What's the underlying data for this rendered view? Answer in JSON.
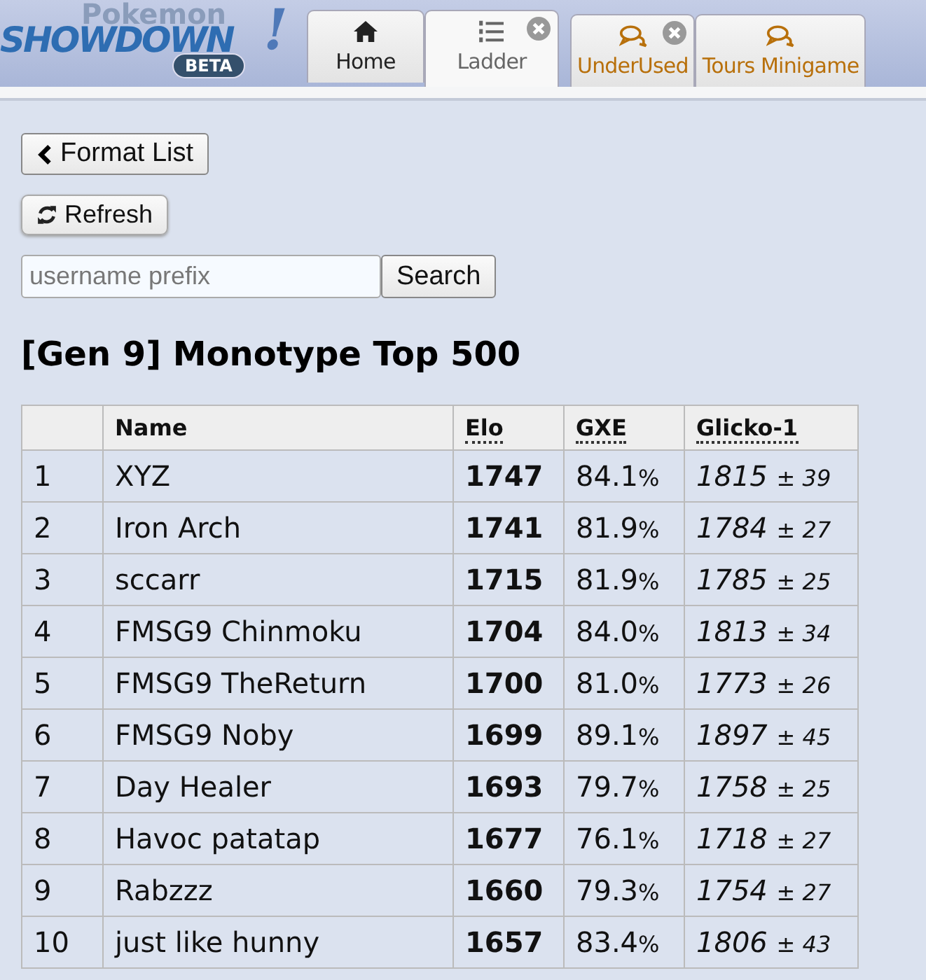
{
  "logo": {
    "top": "Pokemon",
    "main": "SHOWDOWN",
    "mark": "!",
    "badge": "BETA"
  },
  "tabs": [
    {
      "label": "Home",
      "kind": "home",
      "selected": false,
      "closable": false
    },
    {
      "label": "Ladder",
      "kind": "ladder",
      "selected": true,
      "closable": true
    },
    {
      "label": "UnderUsed",
      "kind": "room",
      "selected": false,
      "closable": true
    },
    {
      "label": "Tours Minigame",
      "kind": "room",
      "selected": false,
      "closable": false
    }
  ],
  "buttons": {
    "back": "Format List",
    "refresh": "Refresh"
  },
  "search": {
    "placeholder": "username prefix",
    "button": "Search"
  },
  "title": "[Gen 9] Monotype Top 500",
  "table": {
    "columns": [
      "Name",
      "Elo",
      "GXE",
      "Glicko-1"
    ],
    "rows": [
      {
        "rank": "1",
        "name": "XYZ",
        "elo": "1747",
        "gxe": "84.1",
        "gxe_unit": "%",
        "glicko": "1815",
        "deviation": "± 39"
      },
      {
        "rank": "2",
        "name": "Iron Arch",
        "elo": "1741",
        "gxe": "81.9",
        "gxe_unit": "%",
        "glicko": "1784",
        "deviation": "± 27"
      },
      {
        "rank": "3",
        "name": "sccarr",
        "elo": "1715",
        "gxe": "81.9",
        "gxe_unit": "%",
        "glicko": "1785",
        "deviation": "± 25"
      },
      {
        "rank": "4",
        "name": "FMSG9 Chinmoku",
        "elo": "1704",
        "gxe": "84.0",
        "gxe_unit": "%",
        "glicko": "1813",
        "deviation": "± 34"
      },
      {
        "rank": "5",
        "name": "FMSG9 TheReturn",
        "elo": "1700",
        "gxe": "81.0",
        "gxe_unit": "%",
        "glicko": "1773",
        "deviation": "± 26"
      },
      {
        "rank": "6",
        "name": "FMSG9 Noby",
        "elo": "1699",
        "gxe": "89.1",
        "gxe_unit": "%",
        "glicko": "1897",
        "deviation": "± 45"
      },
      {
        "rank": "7",
        "name": "Day Healer",
        "elo": "1693",
        "gxe": "79.7",
        "gxe_unit": "%",
        "glicko": "1758",
        "deviation": "± 25"
      },
      {
        "rank": "8",
        "name": "Havoc patatap",
        "elo": "1677",
        "gxe": "76.1",
        "gxe_unit": "%",
        "glicko": "1718",
        "deviation": "± 27"
      },
      {
        "rank": "9",
        "name": "Rabzzz",
        "elo": "1660",
        "gxe": "79.3",
        "gxe_unit": "%",
        "glicko": "1754",
        "deviation": "± 27"
      },
      {
        "rank": "10",
        "name": "just like hunny",
        "elo": "1657",
        "gxe": "83.4",
        "gxe_unit": "%",
        "glicko": "1806",
        "deviation": "± 43"
      }
    ]
  }
}
